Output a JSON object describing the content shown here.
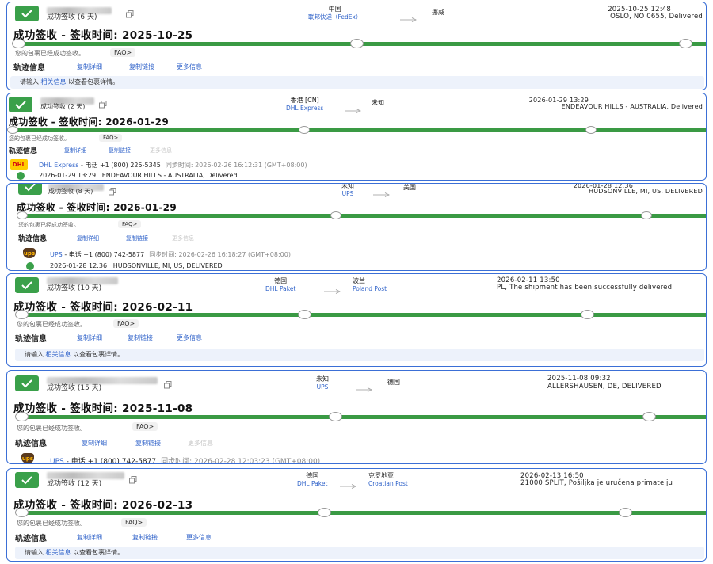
{
  "cards": [
    {
      "status_days": "成功签收 (6 天)",
      "origin": "中国",
      "origin_carrier": "联邦快递（FedEx）",
      "dest": "挪威",
      "dest_carrier": "",
      "latest_time": "2025-10-25 12:48",
      "latest_loc": "OSLO, NO 0655, Delivered",
      "headline": "成功签收 - 签收时间: 2025-10-25",
      "subtext": "您的包裹已经成功签收。",
      "faq": "FAQ>",
      "track_label": "轨迹信息",
      "links": [
        "复制详细",
        "复制链接",
        "更多信息"
      ],
      "hint_pre": "请输入",
      "hint_link": "相关信息",
      "hint_post": "以查看包裹详情。"
    },
    {
      "status_days": "成功签收 (2 天)",
      "origin": "香港 [CN]",
      "origin_carrier": "DHL Express",
      "dest": "未知",
      "dest_carrier": "",
      "latest_time": "2026-01-29 13:29",
      "latest_loc": "ENDEAVOUR HILLS - AUSTRALIA, Delivered",
      "headline": "成功签收 - 签收时间: 2026-01-29",
      "subtext": "您的包裹已经成功签收。",
      "faq": "FAQ>",
      "track_label": "轨迹信息",
      "links": [
        "复制详细",
        "复制链接",
        "更多信息"
      ],
      "carrier_logo": "DHL",
      "carrier_name": "DHL Express",
      "carrier_phone": "- 电话 +1 (800) 225-5345",
      "sync_time": "同步时间: 2026-02-26 16:12:31 (GMT+08:00)",
      "event_time": "2026-01-29 13:29",
      "event_desc": "ENDEAVOUR HILLS - AUSTRALIA, Delivered"
    },
    {
      "status_days": "成功签收 (8 天)",
      "origin": "未知",
      "origin_carrier": "UPS",
      "dest": "美国",
      "dest_carrier": "",
      "latest_time": "2026-01-28 12:36",
      "latest_loc": "HUDSONVILLE, MI, US, DELIVERED",
      "headline": "成功签收 - 签收时间: 2026-01-29",
      "subtext": "您的包裹已经成功签收。",
      "faq": "FAQ>",
      "track_label": "轨迹信息",
      "links": [
        "复制详细",
        "复制链接",
        "更多信息"
      ],
      "carrier_logo": "ups",
      "carrier_name": "UPS",
      "carrier_phone": "- 电话 +1 (800) 742-5877",
      "sync_time": "同步时间: 2026-02-26 16:18:27 (GMT+08:00)",
      "event_time": "2026-01-28 12:36",
      "event_desc": "HUDSONVILLE, MI, US, DELIVERED"
    },
    {
      "status_days": "成功签收 (10 天)",
      "origin": "德国",
      "origin_carrier": "DHL Paket",
      "dest": "波兰",
      "dest_carrier": "Poland Post",
      "latest_time": "2026-02-11 13:50",
      "latest_loc": "PL, The shipment has been successfully delivered",
      "headline": "成功签收 - 签收时间: 2026-02-11",
      "subtext": "您的包裹已经成功签收。",
      "faq": "FAQ>",
      "track_label": "轨迹信息",
      "links": [
        "复制详细",
        "复制链接",
        "更多信息"
      ],
      "hint_pre": "请输入",
      "hint_link": "相关信息",
      "hint_post": "以查看包裹详情。"
    },
    {
      "status_days": "成功签收 (15 天)",
      "origin": "未知",
      "origin_carrier": "UPS",
      "dest": "德国",
      "dest_carrier": "",
      "latest_time": "2025-11-08 09:32",
      "latest_loc": "ALLERSHAUSEN, DE, DELIVERED",
      "headline": "成功签收 - 签收时间: 2025-11-08",
      "subtext": "您的包裹已经成功签收。",
      "faq": "FAQ>",
      "track_label": "轨迹信息",
      "links": [
        "复制详细",
        "复制链接",
        "更多信息"
      ],
      "carrier_logo": "ups",
      "carrier_name": "UPS",
      "carrier_phone": "- 电话 +1 (800) 742-5877",
      "sync_time": "同步时间: 2026-02-28 12:03:23 (GMT+08:00)"
    },
    {
      "status_days": "成功签收 (12 天)",
      "origin": "德国",
      "origin_carrier": "DHL Paket",
      "dest": "克罗地亚",
      "dest_carrier": "Croatian Post",
      "latest_time": "2026-02-13 16:50",
      "latest_loc": "21000 SPLIT, Pošiljka je uručena primatelju",
      "headline": "成功签收 - 签收时间: 2026-02-13",
      "subtext": "您的包裹已经成功签收。",
      "faq": "FAQ>",
      "track_label": "轨迹信息",
      "links": [
        "复制详细",
        "复制链接",
        "更多信息"
      ],
      "hint_pre": "请输入",
      "hint_link": "相关信息",
      "hint_post": "以查看包裹详情。"
    }
  ]
}
